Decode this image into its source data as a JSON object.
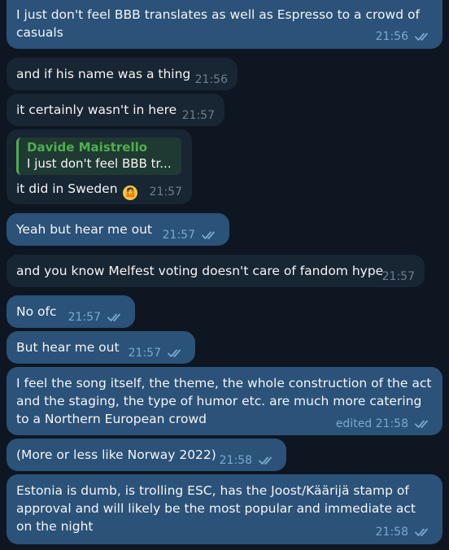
{
  "messages": [
    {
      "dir": "out",
      "text": "I just don't feel BBB translates as well as Espresso to a crowd of casuals",
      "time": "21:56",
      "checks": true
    },
    {
      "dir": "in",
      "text": "and if his name was a thing",
      "time": "21:56"
    },
    {
      "dir": "in",
      "text": "it certainly wasn't in here",
      "time": "21:57"
    },
    {
      "dir": "in",
      "reply": {
        "name": "Davide Maistrello",
        "text": "I just don't feel BBB tr..."
      },
      "text": "it did in Sweden",
      "emoji": "shrug-emoji",
      "time": "21:57"
    },
    {
      "dir": "out",
      "text": "Yeah but hear me out",
      "time": "21:57",
      "checks": true
    },
    {
      "dir": "in",
      "text": "and you know Melfest voting doesn't care of fandom hype",
      "time": "21:57"
    },
    {
      "dir": "out",
      "text": "No ofc",
      "time": "21:57",
      "checks": true
    },
    {
      "dir": "out",
      "text": "But hear me out",
      "time": "21:57",
      "checks": true
    },
    {
      "dir": "out",
      "text": "I feel the song itself, the theme, the whole construction of the act and the staging, the type of humor etc. are much more catering to a Northern European crowd",
      "time": "edited 21:58",
      "checks": true
    },
    {
      "dir": "out",
      "text": "(More or less like Norway 2022)",
      "time": "21:58",
      "checks": true
    },
    {
      "dir": "out",
      "text": "Estonia is dumb, is trolling ESC, has the Joost/Käärijä stamp of approval and will likely be the most popular and immediate act on the night",
      "time": "21:58",
      "checks": true
    }
  ],
  "colors": {
    "out_bubble": "#2b5278",
    "in_bubble": "#182533",
    "background": "#0e1621",
    "reply_accent": "#4fae4e"
  }
}
